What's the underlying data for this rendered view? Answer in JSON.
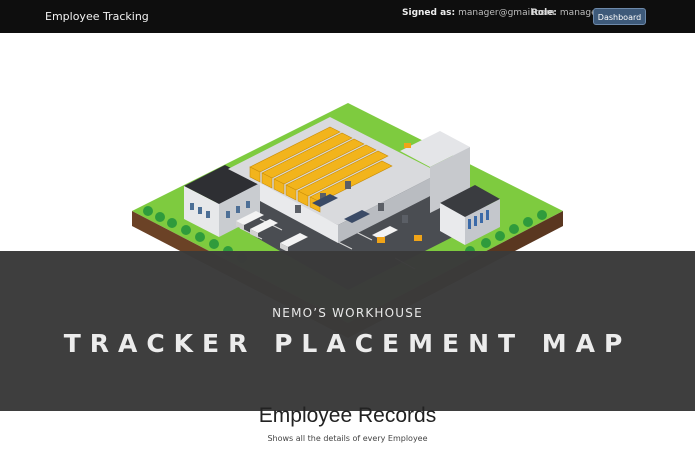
{
  "navbar": {
    "brand": "Employee Tracking",
    "signed_label": "Signed as:",
    "signed_value": "manager@gmail.com",
    "role_label": "Role:",
    "role_value": "manager",
    "dashboard_label": "Dashboard"
  },
  "hero": {
    "subtitle": "NEMO’S WORKHOUSE",
    "title": "TRACKER PLACEMENT MAP"
  },
  "records": {
    "title": "Employee Records",
    "subtitle": "Shows all the details of every Employee"
  },
  "colors": {
    "navbar_bg": "#0e0e0e",
    "button_bg": "#3e5a7a",
    "overlay_bg": "#3a3a3a",
    "grass": "#7ecb3f",
    "rack": "#f2b41c"
  }
}
